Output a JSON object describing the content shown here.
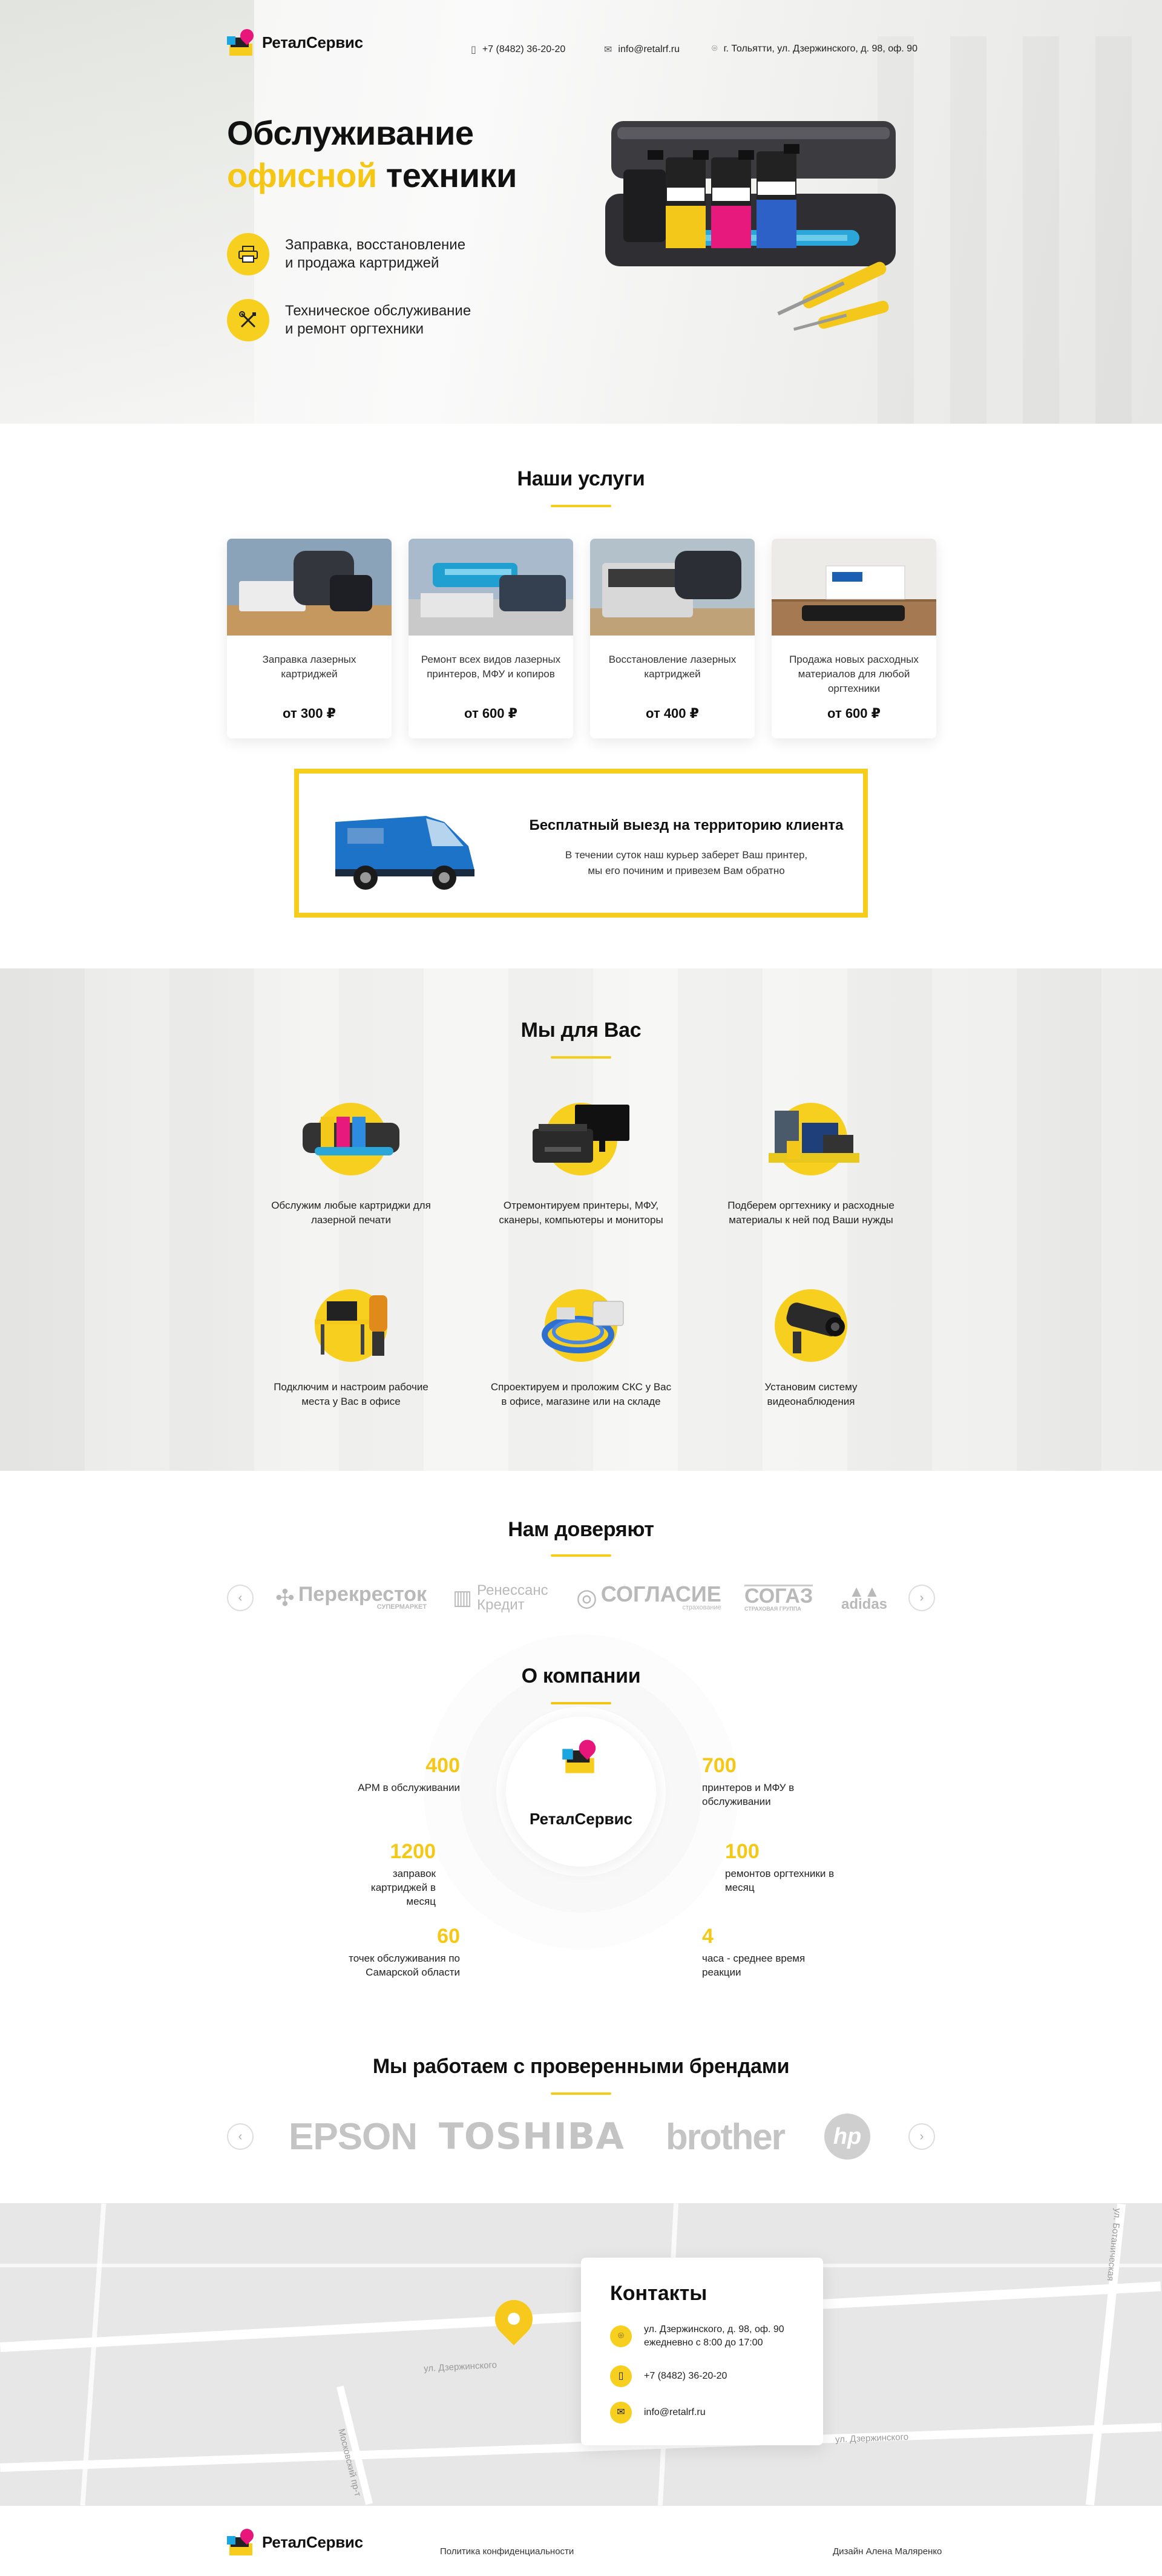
{
  "brand": {
    "name": "РеталСервис"
  },
  "header": {
    "phone": "+7 (8482) 36-20-20",
    "email": "info@retalrf.ru",
    "address": "г. Тольятти, ул. Дзержинского, д. 98, оф. 90"
  },
  "hero": {
    "title_line1": "Обслуживание",
    "title_highlight": "офисной",
    "title_rest": " техники",
    "features": [
      {
        "line1": "Заправка, восстановление",
        "line2": "и продажа картриджей"
      },
      {
        "line1": "Техническое обслуживание",
        "line2": "и ремонт оргтехники"
      }
    ]
  },
  "services": {
    "title": "Наши услуги",
    "cards": [
      {
        "text": "Заправка лазерных картриджей",
        "price": "от 300 ₽"
      },
      {
        "text": "Ремонт всех видов лазерных принтеров, МФУ и копиров",
        "price": "от 600 ₽"
      },
      {
        "text": "Восстановление лазерных картриджей",
        "price": "от 400 ₽"
      },
      {
        "text": "Продажа новых расходных материалов для любой оргтехники",
        "price": "от 600 ₽"
      }
    ]
  },
  "delivery": {
    "title": "Бесплатный выезд на территорию клиента",
    "text_line1": "В течении суток наш курьер заберет Ваш принтер,",
    "text_line2": "мы его починим и привезем Вам обратно"
  },
  "for_you": {
    "title": "Мы для Вас",
    "items": [
      {
        "text": "Обслужим любые картриджи для лазерной печати"
      },
      {
        "text": "Отремонтируем принтеры, МФУ, сканеры, компьютеры и мониторы"
      },
      {
        "text": "Подберем оргтехнику и расходные материалы к ней под Ваши нужды"
      },
      {
        "text": "Подключим и настроим рабочие места у Вас в офисе"
      },
      {
        "text": "Спроектируем и проложим СКС у Вас в офисе, магазине или на складе"
      },
      {
        "text": "Установим систему видеонаблюдения"
      }
    ]
  },
  "trust": {
    "title": "Нам доверяют",
    "partners": [
      {
        "name": "Перекресток",
        "sub": "СУПЕРМАРКЕТ"
      },
      {
        "name": "Ренессанс Кредит",
        "sub": ""
      },
      {
        "name": "СОГЛАСИЕ",
        "sub": "страхование"
      },
      {
        "name": "СОГАЗ",
        "sub": "СТРАХОВАЯ ГРУППА"
      },
      {
        "name": "adidas",
        "sub": ""
      }
    ],
    "prev": "‹",
    "next": "›"
  },
  "about": {
    "title": "О компании",
    "logo_text": "РеталСервис",
    "stats": [
      {
        "num": "400",
        "label": "АРМ в обслуживании"
      },
      {
        "num": "1200",
        "label": "заправок картриджей в месяц"
      },
      {
        "num": "60",
        "label": "точек обслуживания по Самарской области"
      },
      {
        "num": "700",
        "label": "принтеров и МФУ в обслуживании"
      },
      {
        "num": "100",
        "label": "ремонтов оргтехники в месяц"
      },
      {
        "num": "4",
        "label": "часа - среднее время реакции"
      }
    ]
  },
  "brands": {
    "title": "Мы работаем с проверенными брендами",
    "items": [
      "EPSON",
      "TOSHIBA",
      "brother",
      "hp"
    ],
    "prev": "‹",
    "next": "›"
  },
  "map": {
    "street1": "ул. Дзержинского",
    "street2": "ул. Дзержинского",
    "street3": "ул. Ботаническая",
    "street4": "Московский пр-т"
  },
  "contacts": {
    "title": "Контакты",
    "address_line1": "ул. Дзержинского, д. 98, оф. 90",
    "address_line2": "ежедневно с 8:00 до 17:00",
    "phone": "+7 (8482) 36-20-20",
    "email": "info@retalrf.ru"
  },
  "footer": {
    "privacy": "Политика конфиденциальности",
    "design": "Дизайн Алена Маляренко"
  },
  "colors": {
    "accent": "#f6cc1a",
    "magenta": "#e8157a",
    "cyan": "#1aa6e0"
  }
}
